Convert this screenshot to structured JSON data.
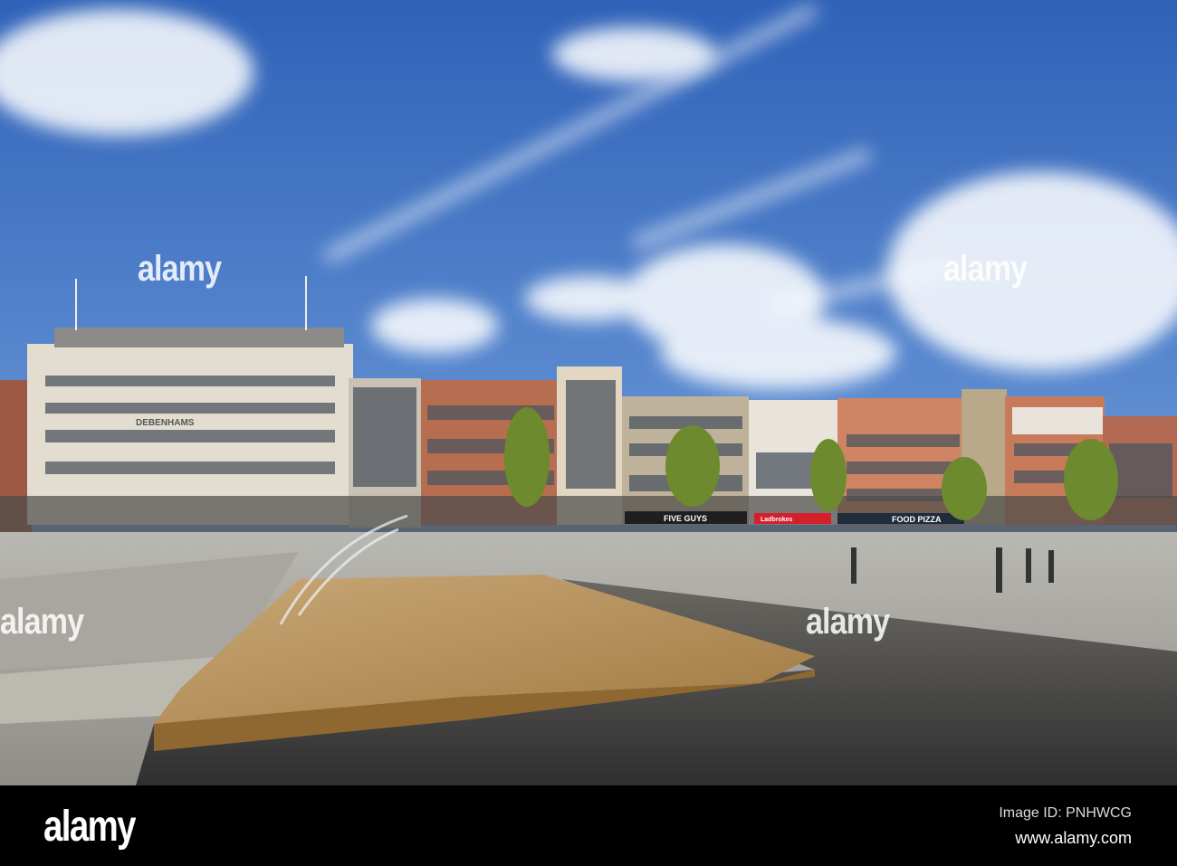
{
  "photo": {
    "description_signs": {
      "store_name": "DEBENHAMS",
      "shop_1": "FIVE GUYS",
      "shop_2": "Ladbrokes",
      "shop_3": "FOOD PIZZA"
    }
  },
  "watermark": {
    "text": "alamy"
  },
  "footer": {
    "logo": "alamy",
    "image_id": "Image ID: PNHWCG",
    "url": "www.alamy.com"
  },
  "colors": {
    "sky_top": "#3a6cc0",
    "sky_bottom": "#a9c6e8",
    "footer": "#000000"
  }
}
